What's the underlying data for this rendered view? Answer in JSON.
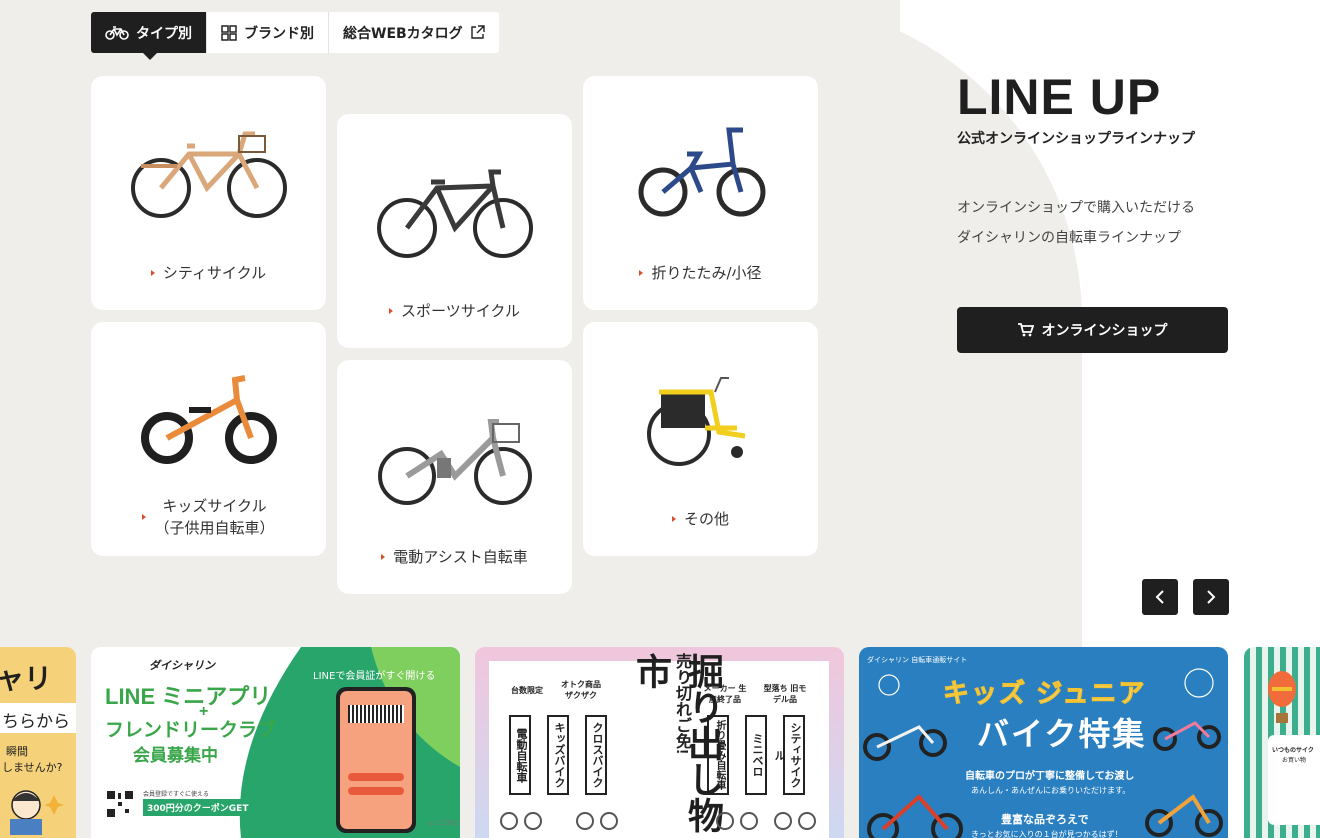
{
  "tabs": [
    {
      "label": "タイプ別",
      "icon": "bicycle-icon",
      "active": true
    },
    {
      "label": "ブランド別",
      "icon": "grid-icon",
      "active": false
    },
    {
      "label": "総合WEBカタログ",
      "icon": "external-link-icon",
      "active": false
    }
  ],
  "products": {
    "city": "シティサイクル",
    "sports": "スポーツサイクル",
    "folding": "折りたたみ/小径",
    "kids_line1": "キッズサイクル",
    "kids_line2": "（子供用自転車）",
    "assist": "電動アシスト自転車",
    "other": "その他"
  },
  "lineup": {
    "title": "LINE UP",
    "subtitle": "公式オンラインショップラインナップ",
    "desc_line1": "オンラインショップで購入いただける",
    "desc_line2": "ダイシャリンの自転車ラインナップ",
    "shop_button": "オンラインショップ"
  },
  "banners": {
    "partial_left": {
      "brand": "ャリン",
      "line1": "ちらから",
      "line2": "瞬間",
      "line3": "しませんか?"
    },
    "line": {
      "brand": "ダイシャリン",
      "title1": "LINE ミニアプリ",
      "plus": "+",
      "title2": "フレンドリークラブ",
      "title3": "会員募集中",
      "bubble": "LINEで会員証がすぐ開ける",
      "coupon_small": "会員登録ですぐに使える",
      "coupon": "300円分のクーポンGET",
      "version": "v.1.2303"
    },
    "sale": {
      "headline": "掘り出し物市",
      "vertical_small": "売り切れご免!",
      "tags": [
        "台数限定",
        "オトク商品 ザクザク",
        "メーカー 生産終了品",
        "型落ち 旧モデル品"
      ],
      "items": [
        "電動自転車",
        "キッズバイク",
        "クロスバイク",
        "折り畳み自転車",
        "ミニベロ",
        "シティサイクル"
      ]
    },
    "kids": {
      "site": "ダイシャリン 自転車通販サイト",
      "title1": "キッズ ジュニア",
      "title2": "バイク特集",
      "line1": "自転車のプロが丁寧に整備してお渡し",
      "line2": "あんしん・あんぜんにお乗りいただけます。",
      "line3": "豊富な品ぞろえで",
      "line4": "きっとお気に入りの１台が見つかるはず！"
    },
    "partial_right": {
      "line1": "いつものサイク",
      "line2": "お買い物"
    }
  }
}
